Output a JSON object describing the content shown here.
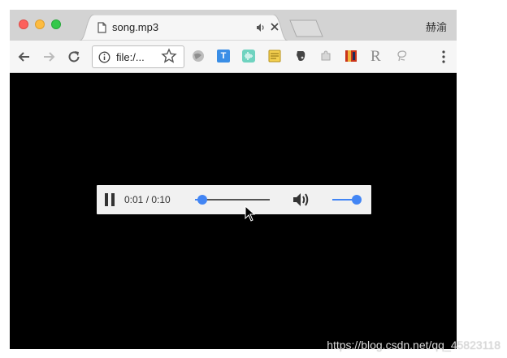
{
  "browser": {
    "tab": {
      "title": "song.mp3",
      "icon": "document-icon",
      "audio_indicator": "speaker-icon",
      "close": "close-icon"
    },
    "profile_name": "赫渝",
    "toolbar": {
      "back": "arrow-left-icon",
      "forward": "arrow-right-icon",
      "reload": "reload-icon",
      "url": "file:/...",
      "site_info": "info-icon",
      "bookmark": "star-icon",
      "extensions": [
        "globe-icon",
        "T",
        "waveform-icon",
        "notes-icon",
        "evernote-icon",
        "puzzle-icon",
        "book-icon",
        "R",
        "lasso-icon"
      ],
      "menu": "kebab-menu-icon"
    }
  },
  "player": {
    "state": "playing",
    "time": "0:01 / 0:10",
    "progress": 0.1,
    "volume": 1.0,
    "accent_color": "#4285f4"
  },
  "watermark": "https://blog.csdn.net/qq_45823118"
}
